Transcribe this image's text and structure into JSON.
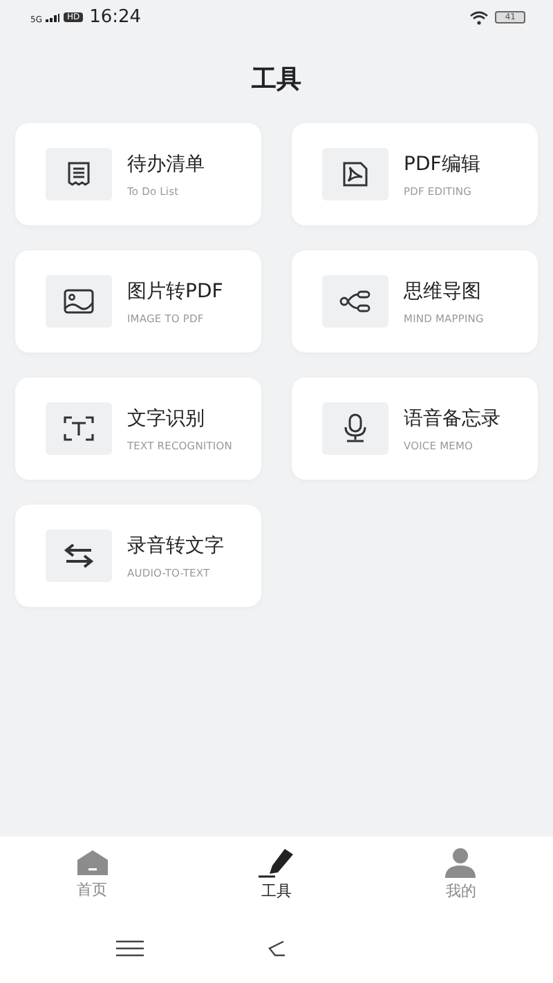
{
  "status_bar": {
    "network": "5G",
    "hd_badge": "HD",
    "time": "16:24",
    "battery": "41"
  },
  "title": "工具",
  "tools": [
    {
      "title": "待办清单",
      "subtitle": "To Do List"
    },
    {
      "title": "PDF编辑",
      "subtitle": "PDF EDITING"
    },
    {
      "title": "图片转PDF",
      "subtitle": "IMAGE TO PDF"
    },
    {
      "title": "思维导图",
      "subtitle": "MIND MAPPING"
    },
    {
      "title": "文字识别",
      "subtitle": "TEXT RECOGNITION"
    },
    {
      "title": "语音备忘录",
      "subtitle": "VOICE MEMO"
    },
    {
      "title": "录音转文字",
      "subtitle": "AUDIO-TO-TEXT"
    }
  ],
  "tab_bar": [
    {
      "label": "首页",
      "selected": false
    },
    {
      "label": "工具",
      "selected": true
    },
    {
      "label": "我的",
      "selected": false
    }
  ]
}
